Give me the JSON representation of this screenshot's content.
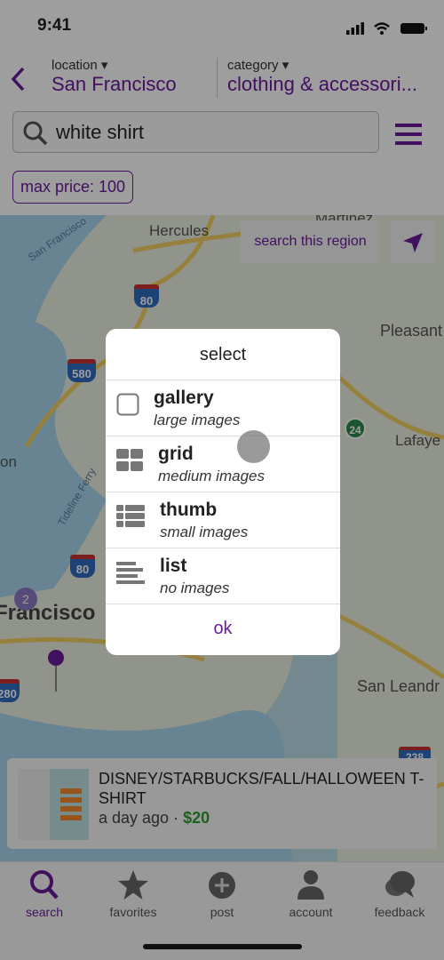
{
  "status": {
    "time": "9:41"
  },
  "header": {
    "location_label": "location ▾",
    "location_value": "San Francisco",
    "category_label": "category ▾",
    "category_value": "clothing & accessori..."
  },
  "search": {
    "value": "white shirt",
    "icon": "search-icon",
    "menu_icon": "hamburger-menu-icon"
  },
  "filters": [
    {
      "label": "max price: 100"
    }
  ],
  "map": {
    "search_region_label": "search this region",
    "labels": [
      "Hercules",
      "Martinez",
      "San Francisco",
      "Pleasant",
      "Lafaye",
      "on",
      "Tideline Ferry",
      "Francisco",
      "San Leandr"
    ],
    "shields": [
      "80",
      "580",
      "80",
      "280",
      "24",
      "238"
    ],
    "cluster": "2"
  },
  "modal": {
    "title": "select",
    "options": [
      {
        "title": "gallery",
        "subtitle": "large images",
        "icon": "checkbox-icon"
      },
      {
        "title": "grid",
        "subtitle": "medium images",
        "icon": "grid-icon"
      },
      {
        "title": "thumb",
        "subtitle": "small images",
        "icon": "thumb-list-icon"
      },
      {
        "title": "list",
        "subtitle": "no images",
        "icon": "list-icon"
      }
    ],
    "ok_label": "ok"
  },
  "listing": {
    "title": "DISNEY/STARBUCKS/FALL/HALLOWEEN T-SHIRT",
    "time": "a day ago",
    "separator": " · ",
    "price": "$20"
  },
  "tabs": [
    {
      "label": "search",
      "active": true
    },
    {
      "label": "favorites"
    },
    {
      "label": "post"
    },
    {
      "label": "account"
    },
    {
      "label": "feedback"
    }
  ],
  "colors": {
    "accent": "#6a1b9a",
    "price": "#2e9e2e"
  }
}
